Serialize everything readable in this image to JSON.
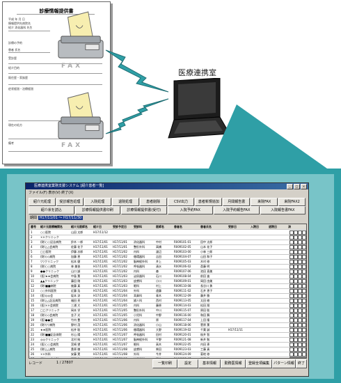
{
  "room_label": "医療連携室",
  "fax_label": "FAX",
  "document": {
    "title": "診療情報提供書",
    "lines": [
      "平成 年 月 日",
      "情報提供先病院名",
      "紹介 消化器科 先生",
      "診療の予約",
      "患者 氏名",
      "受診歴",
      "紹介目的",
      "既往歴・家族歴",
      "症状経過・治療経過",
      "現在の処方",
      "備考"
    ]
  },
  "app": {
    "title": "医療連携室業務支援システム [紹介患者一覧]",
    "menu": "ファイル(F) 表示(V) 終了(X)",
    "buttons_row1": [
      "紹介元処理",
      "受診報告処理",
      "入院処理",
      "退院処理",
      "患者削除",
      "CSV出力",
      "患者新規追加",
      "月間報告書",
      "来院FAX",
      "来院FAX2"
    ],
    "buttons_row2": [
      "紹介状を読込",
      "診療情報提供書印刷",
      "診療情報提供書(受付)",
      "入院予約FAX",
      "入院予約報告FAX",
      "入院報告書FAX"
    ],
    "filter_label": "期間",
    "filter_value": "H17/11/01 ～ H17/11/30",
    "columns": [
      "番号",
      "紹介元医療機関名",
      "紹介元医師名",
      "紹介日",
      "受診予定日",
      "受診科",
      "医師名",
      "患者名",
      "患者氏名",
      "受診日",
      "入院日",
      "退院日",
      "済"
    ],
    "rows": [
      [
        "1",
        "○○医院",
        "山田 太郎",
        "H17/11/12",
        "",
        "",
        "",
        "",
        "",
        "",
        "",
        "",
        ""
      ],
      [
        "2",
        "××クリニック",
        "",
        "",
        "",
        "",
        "",
        "",
        "",
        "",
        "",
        "",
        ""
      ],
      [
        "3",
        "(財)○○記念病院",
        "鈴木 一郎",
        "H17/11/01",
        "H17/11/01",
        "消化器科",
        "中村",
        "R009101-01",
        "田中 太郎",
        "",
        "",
        "",
        ""
      ],
      [
        "4",
        "(財)△△会病院",
        "佐藤 花子",
        "H17/11/01",
        "H17/11/01",
        "整形外科",
        "高橋",
        "R009102-05",
        "山本 花子",
        "",
        "",
        "",
        ""
      ],
      [
        "5",
        "□□医院",
        "伊藤 次郎",
        "H17/11/01",
        "H17/11/02",
        "内科",
        "渡辺",
        "R009103-00",
        "小林 三郎",
        "",
        "",
        "",
        ""
      ],
      [
        "6",
        "(財)◇◇病院",
        "加藤 恵",
        "H17/11/01",
        "H17/11/02",
        "循環器科",
        "吉田",
        "R009104-07",
        "山田 和子",
        "",
        "",
        "",
        ""
      ],
      [
        "7",
        "▽▽クリニック",
        "松本 健",
        "H17/11/01",
        "H17/11/02",
        "脳神経外科",
        "井上",
        "R009105-03",
        "木村 修",
        "",
        "",
        "",
        ""
      ],
      [
        "8",
        "(財)○○病院",
        "林 美香",
        "H17/11/01",
        "H17/11/02",
        "呼吸器科",
        "清水",
        "R009106-02",
        "斎藤 明",
        "",
        "",
        "",
        ""
      ],
      [
        "9",
        "●●クリニック",
        "山口 誠",
        "H17/11/01",
        "H17/11/02",
        "内科",
        "森",
        "R009107-06",
        "池田 直美",
        "",
        "",
        "",
        ""
      ],
      [
        "10",
        "(医)★★会病院",
        "中島 薫",
        "H17/11/01",
        "H17/11/03",
        "泌尿器科",
        "石川",
        "R009108-04",
        "前田 進",
        "",
        "",
        "",
        ""
      ],
      [
        "11",
        "▲▲クリニック",
        "藤田 剛",
        "H17/11/01",
        "H17/11/03",
        "皮膚科",
        "小川",
        "R009109-01",
        "岡田 由美",
        "",
        "",
        "",
        ""
      ],
      [
        "12",
        "(財)■■病院",
        "後藤 真",
        "H17/11/01",
        "H17/11/03",
        "眼科",
        "村上",
        "R009110-08",
        "長谷川 勇",
        "",
        "",
        "",
        ""
      ],
      [
        "13",
        "○○外科医院",
        "近藤 浩",
        "H17/11/01",
        "H17/11/04",
        "外科",
        "遠藤",
        "R009111-02",
        "石井 恵子",
        "",
        "",
        "",
        ""
      ],
      [
        "14",
        "(医)◎◎会",
        "坂本 涼",
        "H17/11/01",
        "H17/11/04",
        "耳鼻科",
        "青木",
        "R009112-09",
        "藤井 勝",
        "",
        "",
        "",
        ""
      ],
      [
        "15",
        "(財)△△記念病院",
        "福田 亮",
        "H17/11/01",
        "H17/11/04",
        "婦人科",
        "西村",
        "R009113-05",
        "太田 綾",
        "",
        "",
        "",
        ""
      ],
      [
        "16",
        "(医)××会病院",
        "三浦 大",
        "H17/11/01",
        "H17/11/05",
        "内科",
        "藤原",
        "R009114-03",
        "松田 翔",
        "",
        "",
        "",
        ""
      ],
      [
        "17",
        "□□クリニック",
        "岡本 学",
        "H17/11/01",
        "H17/11/05",
        "整形外科",
        "中川",
        "R009115-07",
        "原田 聡",
        "",
        "",
        "",
        ""
      ],
      [
        "18",
        "(財)◇◇会病院",
        "金子 光",
        "H17/11/01",
        "H17/11/05",
        "小児科",
        "中野",
        "R009116-00",
        "和田 舞",
        "",
        "",
        "",
        ""
      ],
      [
        "19",
        "(医)●●会",
        "竹内 豊",
        "H17/11/01",
        "H17/11/06",
        "内科",
        "原",
        "R009117-04",
        "上田 隆",
        "",
        "",
        "",
        ""
      ],
      [
        "20",
        "(財)▽▽病院",
        "野村 茂",
        "H17/11/01",
        "H17/11/06",
        "消化器科",
        "小山",
        "R009118-06",
        "菅原 薫",
        "",
        "",
        "",
        ""
      ],
      [
        "21",
        "★★医院",
        "松井 聡",
        "H17/11/01",
        "H17/11/06",
        "循環器科",
        "大野",
        "R009119-02",
        "千葉 誠",
        "H17/11/11",
        "",
        "",
        ""
      ],
      [
        "22",
        "(財)■■記念病院",
        "杉山 陽",
        "H17/11/01",
        "H17/11/07",
        "呼吸器科",
        "田村",
        "R009120-01",
        "桜井 智",
        "",
        "",
        "",
        ""
      ],
      [
        "23",
        "◎◎クリニック",
        "北村 純",
        "H17/11/01",
        "H17/11/07",
        "脳神経外科",
        "平野",
        "R009121-08",
        "新井 勉",
        "",
        "",
        "",
        ""
      ],
      [
        "24",
        "(医)○○会病院",
        "宮崎 望",
        "H17/11/01",
        "H17/11/07",
        "眼科",
        "高木",
        "R009122-05",
        "内田 恵",
        "",
        "",
        "",
        ""
      ],
      [
        "25",
        "(財)△△病院",
        "桑原 徹",
        "H17/11/01",
        "H17/11/08",
        "皮膚科",
        "柴田",
        "R009123-03",
        "工藤 真",
        "",
        "",
        "",
        ""
      ],
      [
        "26",
        "××外科",
        "安藤 実",
        "H17/11/01",
        "H17/11/08",
        "外科",
        "今井",
        "R009124-09",
        "菊地 修",
        "",
        "",
        "",
        ""
      ],
      [
        "27",
        "(財)□□会病院",
        "河野 隼",
        "H17/11/01",
        "H17/11/08",
        "泌尿器科",
        "酒井",
        "R009125-07",
        "武田 愛",
        "",
        "",
        "",
        ""
      ]
    ],
    "record_label": "レコード",
    "record_counter": "1 / 27807",
    "bottom_buttons": [
      "一覧印刷",
      "設定",
      "基本情報",
      "勤務医情報",
      "登録全項編集",
      "パターン情報",
      "終了"
    ]
  }
}
